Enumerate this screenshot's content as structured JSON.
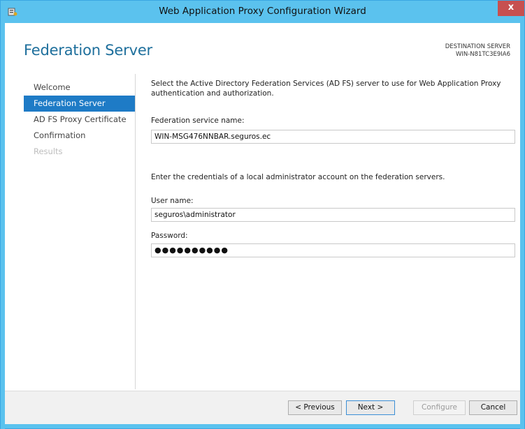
{
  "window": {
    "title": "Web Application Proxy Configuration Wizard",
    "close_label": "x"
  },
  "header": {
    "page_title": "Federation Server",
    "dest_label": "DESTINATION SERVER",
    "dest_server": "WIN-N81TC3E9IA6"
  },
  "nav": {
    "items": [
      {
        "label": "Welcome",
        "state": "normal"
      },
      {
        "label": "Federation Server",
        "state": "active"
      },
      {
        "label": "AD FS Proxy Certificate",
        "state": "normal"
      },
      {
        "label": "Confirmation",
        "state": "normal"
      },
      {
        "label": "Results",
        "state": "disabled"
      }
    ]
  },
  "main": {
    "intro": "Select the Active Directory Federation Services (AD FS) server to use for Web Application Proxy authentication and authorization.",
    "service_name_label": "Federation service name:",
    "service_name_value": "WIN-MSG476NNBAR.seguros.ec",
    "credentials_text": "Enter the credentials of a local administrator account on the federation servers.",
    "username_label": "User name:",
    "username_value": "seguros\\administrator",
    "password_label": "Password:",
    "password_value": "●●●●●●●●●●"
  },
  "footer": {
    "previous_label": "< Previous",
    "next_label": "Next >",
    "configure_label": "Configure",
    "cancel_label": "Cancel"
  },
  "colors": {
    "titlebar": "#5bc2ee",
    "accent": "#1e7bc6",
    "title_text": "#1e6f9c",
    "close": "#c75050"
  }
}
